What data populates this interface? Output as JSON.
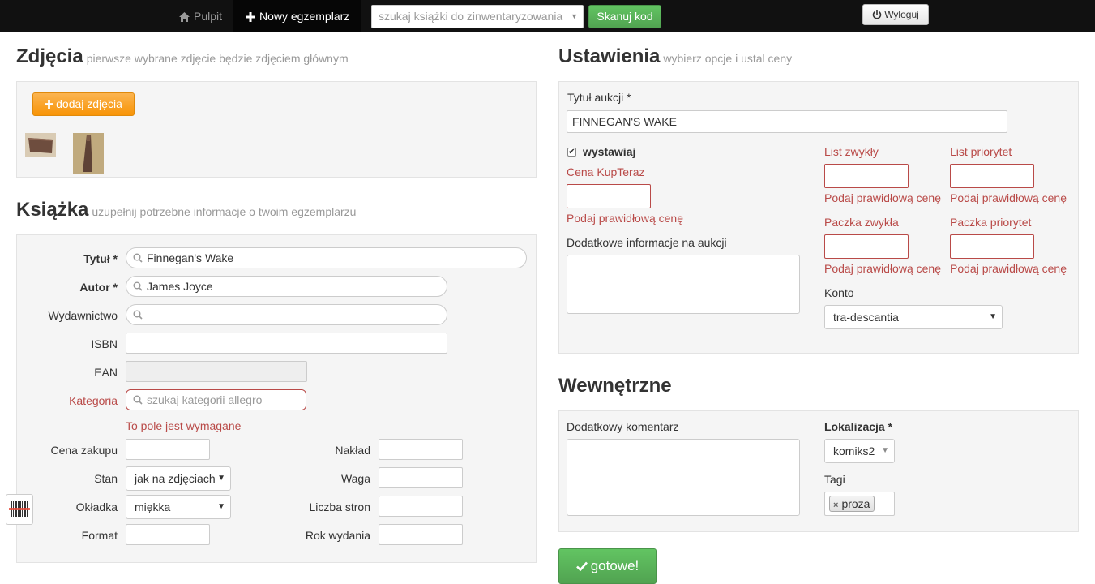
{
  "nav": {
    "dashboard": "Pulpit",
    "new_copy": "Nowy egzemplarz",
    "search_placeholder": "szukaj książki do zinwentaryzowania",
    "scan": "Skanuj kod",
    "logout": "Wyloguj"
  },
  "photos": {
    "title": "Zdjęcia",
    "subtitle": "pierwsze wybrane zdjęcie będzie zdjęciem głównym",
    "add_button": "dodaj zdjęcia"
  },
  "book": {
    "title": "Książka",
    "subtitle": "uzupełnij potrzebne informacje o twoim egzemplarzu",
    "fields": {
      "title_label": "Tytuł *",
      "title_value": "Finnegan's Wake",
      "author_label": "Autor *",
      "author_value": "James Joyce",
      "publisher_label": "Wydawnictwo",
      "publisher_value": "",
      "isbn_label": "ISBN",
      "ean_label": "EAN",
      "category_label": "Kategoria",
      "category_placeholder": "szukaj kategorii allegro",
      "category_error": "To pole jest wymagane",
      "purchase_price_label": "Cena zakupu",
      "condition_label": "Stan",
      "condition_value": "jak na zdjęciach",
      "cover_label": "Okładka",
      "cover_value": "miękka",
      "format_label": "Format",
      "print_run_label": "Nakład",
      "weight_label": "Waga",
      "pages_label": "Liczba stron",
      "year_label": "Rok wydania"
    }
  },
  "settings": {
    "title": "Ustawienia",
    "subtitle": "wybierz opcje i ustal ceny",
    "auction_title_label": "Tytuł aukcji *",
    "auction_title_value": "FINNEGAN'S WAKE",
    "list_label": "wystawiaj",
    "list_checked": true,
    "buy_now_label": "Cena KupTeraz",
    "price_error": "Podaj prawidłową cenę",
    "extra_info_label": "Dodatkowe informacje na aukcji",
    "letter_regular": "List zwykły",
    "letter_priority": "List priorytet",
    "parcel_regular": "Paczka zwykła",
    "parcel_priority": "Paczka priorytet",
    "account_label": "Konto",
    "account_value": "tra-descantia"
  },
  "internal": {
    "title": "Wewnętrzne",
    "comment_label": "Dodatkowy komentarz",
    "location_label": "Lokalizacja *",
    "location_value": "komiks2",
    "tags_label": "Tagi",
    "tags": [
      "proza"
    ]
  },
  "submit": "gotowe!",
  "colors": {
    "error": "#b94a48",
    "success": "#51a351",
    "warning": "#f89406",
    "navbar": "#111111"
  },
  "icons": [
    "home-icon",
    "plus-icon",
    "power-icon",
    "search-icon",
    "check-icon",
    "barcode-icon"
  ]
}
